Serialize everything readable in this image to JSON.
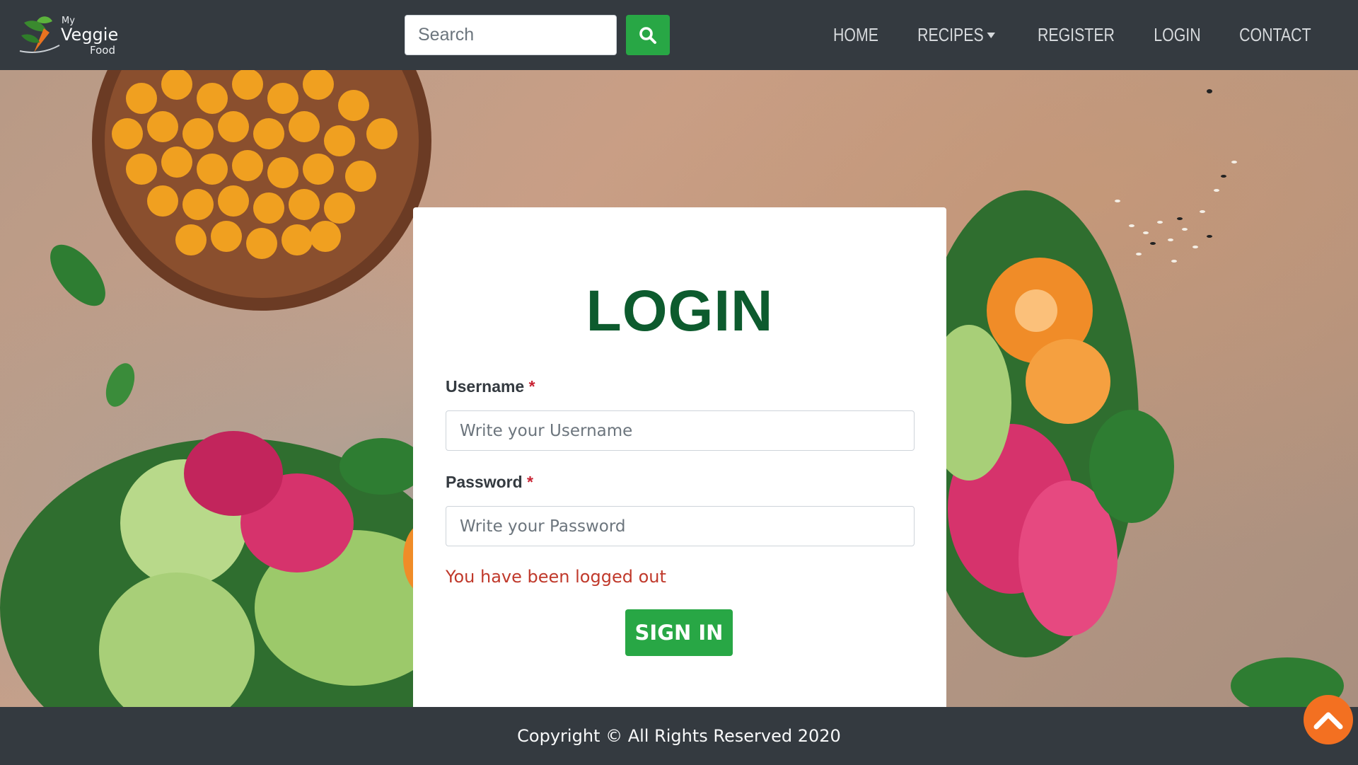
{
  "brand": {
    "line1": "My",
    "line2": "Veggie",
    "line3": "Food"
  },
  "search": {
    "placeholder": "Search",
    "icon": "search-icon"
  },
  "nav": {
    "items": [
      {
        "label": "HOME"
      },
      {
        "label": "RECIPES",
        "has_dropdown": true
      },
      {
        "label": "REGISTER"
      },
      {
        "label": "LOGIN"
      },
      {
        "label": "CONTACT"
      }
    ]
  },
  "login": {
    "title": "LOGIN",
    "username_label": "Username",
    "username_placeholder": "Write your Username",
    "password_label": "Password",
    "password_placeholder": "Write your Password",
    "required_mark": "*",
    "message": "You have been logged out",
    "submit_label": "SIGN IN"
  },
  "footer": {
    "text": "Copyright © All Rights Reserved 2020"
  },
  "colors": {
    "navbar": "#343a40",
    "accent_green": "#28a745",
    "title_green": "#0d5b2e",
    "error_red": "#c0392b",
    "scroll_top_orange": "#f37021"
  }
}
